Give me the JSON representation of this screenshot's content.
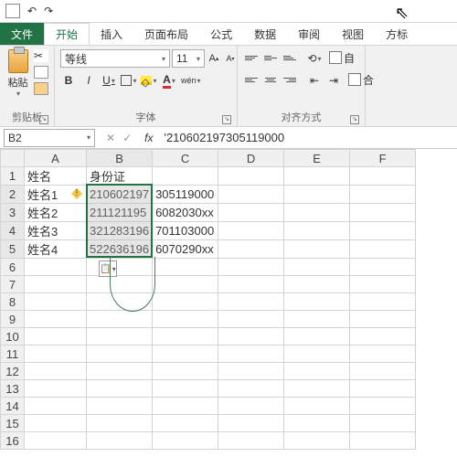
{
  "qat": {
    "undo": "↶",
    "redo": "↷"
  },
  "tabs": {
    "file": "文件",
    "home": "开始",
    "insert": "插入",
    "layout": "页面布局",
    "formulas": "公式",
    "data": "数据",
    "review": "审阅",
    "view": "视图",
    "dev": "方标"
  },
  "ribbon": {
    "clipboard": {
      "paste": "粘贴",
      "label": "剪贴板"
    },
    "font": {
      "name": "等线",
      "size": "11",
      "label": "字体",
      "grow": "A",
      "shrink": "A",
      "bold": "B",
      "italic": "I",
      "underline": "U",
      "ruby": "wén"
    },
    "align": {
      "label": "对齐方式",
      "wrap": "自"
    }
  },
  "namebox": "B2",
  "fx_cancel": "✕",
  "fx_confirm": "✓",
  "fx": "fx",
  "formula": "'210602197305119000",
  "cols": [
    "A",
    "B",
    "C",
    "D",
    "E",
    "F"
  ],
  "chart_data": {
    "type": "table",
    "headers": [
      "姓名",
      "身份证"
    ],
    "rows": [
      [
        "姓名1",
        "210602197305119000"
      ],
      [
        "姓名2",
        "211121195",
        "6082030xx"
      ],
      [
        "姓名3",
        "321283196",
        "701103000"
      ],
      [
        "姓名4",
        "522636196",
        "6070290xx"
      ]
    ]
  },
  "cells": {
    "A1": "姓名",
    "B1": "身份证",
    "A2": "姓名1",
    "B2": "21060219",
    "C2": "305119000",
    "A3": "姓名2",
    "B3": "21112119",
    "C3": "6082030xx",
    "A4": "姓名3",
    "B4": "32128319",
    "C4": "701103000",
    "A5": "姓名4",
    "B5": "52263619",
    "C5": "6070290xx"
  }
}
